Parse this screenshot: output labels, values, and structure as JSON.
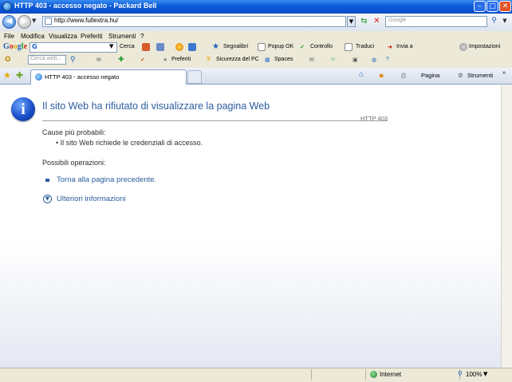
{
  "window": {
    "title": "HTTP 403 - accesso negato - Packard Bell"
  },
  "address": {
    "url": "http://www.fullextra.hu/",
    "search_placeholder": "Google"
  },
  "menu": [
    "File",
    "Modifica",
    "Visualizza",
    "Preferiti",
    "Strumenti",
    "?"
  ],
  "google_toolbar": {
    "logo": "Google",
    "search_value": "G",
    "cerca": "Cerca",
    "segnalibri": "Segnalibri",
    "popup": "Popup OK",
    "controllo": "Controllo",
    "traduci": "Traduci",
    "invia": "Invia a",
    "impostazioni": "Impostazioni"
  },
  "toolbar3": {
    "search_placeholder": "Cerca web...",
    "preferiti": "Preferiti",
    "sicurezza": "Sicurezza del PC",
    "spaces": "Spaces"
  },
  "tab": {
    "label": "HTTP 403 - accesso negato"
  },
  "commands": {
    "pagina": "Pagina",
    "strumenti": "Strumenti"
  },
  "content": {
    "heading": "Il sito Web ha rifiutato di visualizzare la pagina Web",
    "code": "HTTP 403",
    "causes_title": "Cause più probabili:",
    "cause_1": "Il sito Web richiede le credenziali di accesso.",
    "ops_title": "Possibili operazioni:",
    "back_link": "Torna alla pagina precedente.",
    "more_info": "Ulteriori informazioni"
  },
  "status": {
    "zone": "Internet",
    "zoom": "100%"
  }
}
